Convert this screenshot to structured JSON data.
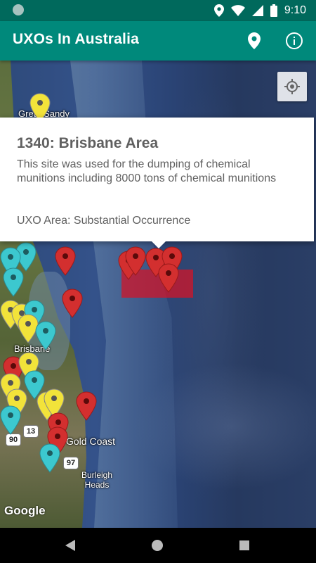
{
  "status": {
    "time": "9:10"
  },
  "app": {
    "title": "UXOs In Australia",
    "location_icon": "map-pin-icon",
    "info_icon": "info-icon"
  },
  "map": {
    "labels": {
      "great_sandy": "Great Sandy",
      "brisbane": "Brisbane",
      "gold_coast": "Gold Coast",
      "burleigh_heads": "Burleigh\nHeads",
      "road_13": "13",
      "road_90": "90",
      "road_97": "97"
    },
    "attribution": "Google",
    "colors": {
      "red": "#d32f2f",
      "yellow": "#f2e33a",
      "cyan": "#3cc8cf",
      "uxo_area": "#d2142a"
    }
  },
  "info_window": {
    "title": "1340: Brisbane Area",
    "description": "This site was used for the dumping of chemical munitions including 8000 tons of chemical munitions",
    "area": "UXO Area: Substantial Occurrence"
  },
  "nav": {
    "back": "back-icon",
    "home": "home-icon",
    "recents": "recents-icon"
  }
}
